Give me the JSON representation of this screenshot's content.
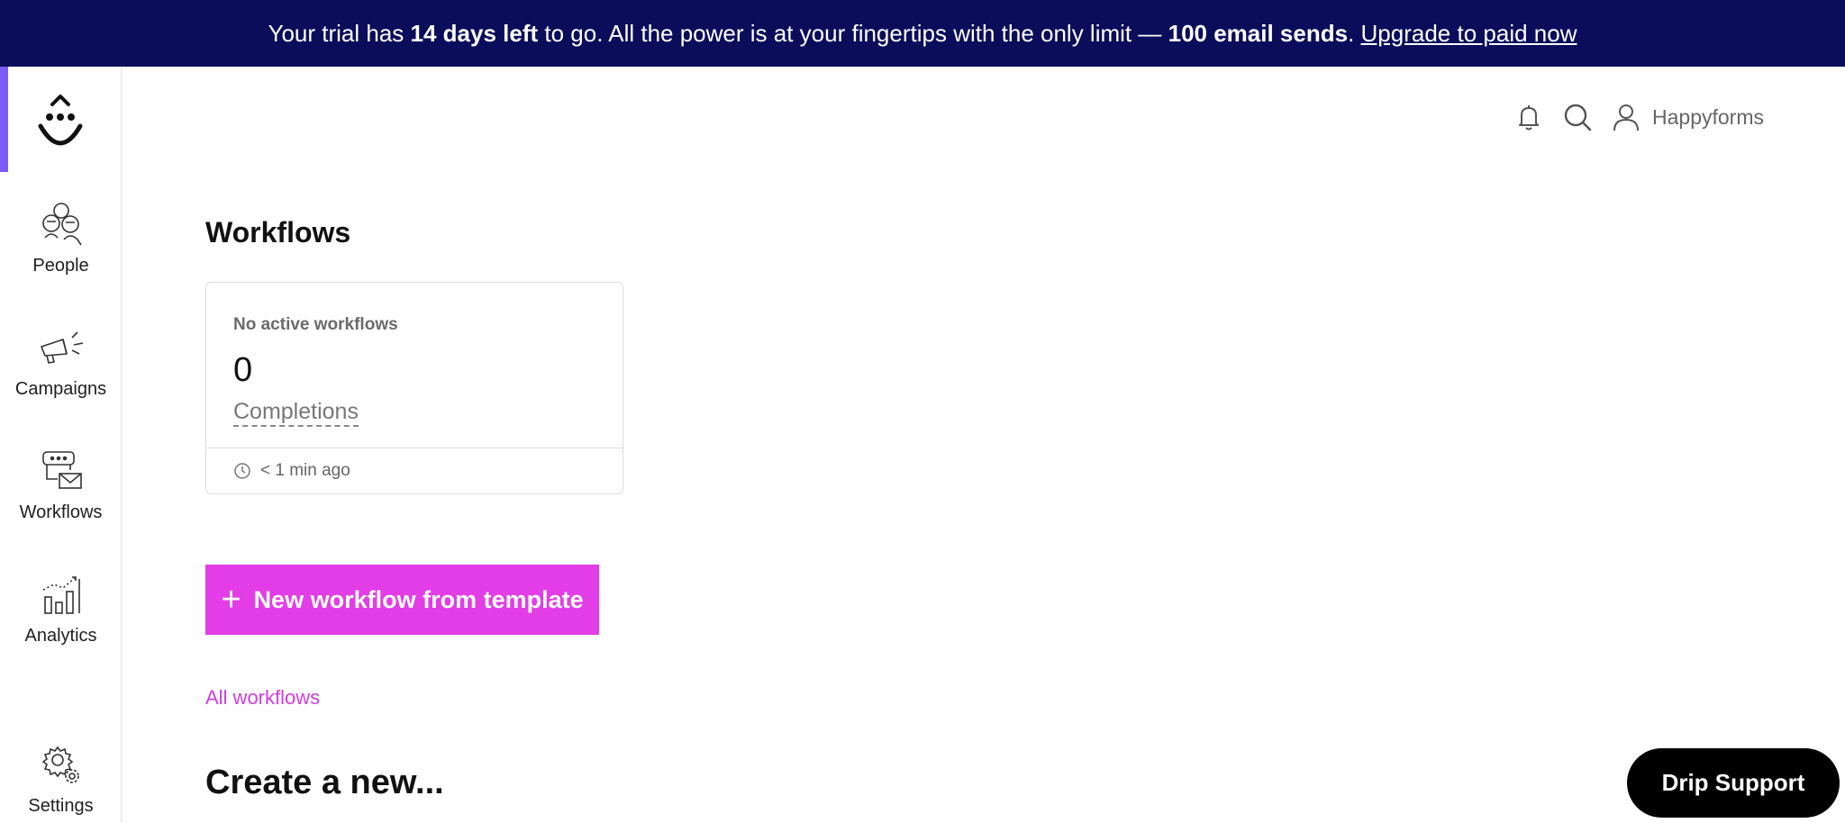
{
  "banner": {
    "text_1": "Your trial has ",
    "days_left": "14 days left",
    "text_2": " to go. All the power is at your fingertips with the only limit — ",
    "limit": "100 email sends",
    "text_3": ". ",
    "upgrade_link": "Upgrade to paid now",
    "background": "#0b0d5b"
  },
  "sidebar": {
    "accent": "#7b5cf5",
    "items": [
      {
        "label": "People",
        "icon": "people-icon"
      },
      {
        "label": "Campaigns",
        "icon": "megaphone-icon"
      },
      {
        "label": "Workflows",
        "icon": "workflow-icon"
      },
      {
        "label": "Analytics",
        "icon": "analytics-icon"
      },
      {
        "label": "Settings",
        "icon": "gear-icon"
      }
    ]
  },
  "header": {
    "user_name": "Happyforms",
    "icons": [
      "bell-icon",
      "search-icon",
      "user-icon"
    ]
  },
  "main": {
    "title": "Workflows",
    "card": {
      "title": "No active workflows",
      "count": "0",
      "metric_label": "Completions",
      "updated": "< 1 min ago"
    },
    "new_button_label": "New workflow from template",
    "new_button_color": "#e23de6",
    "all_link": "All workflows",
    "create_title": "Create a new..."
  },
  "support": {
    "label": "Drip Support"
  }
}
